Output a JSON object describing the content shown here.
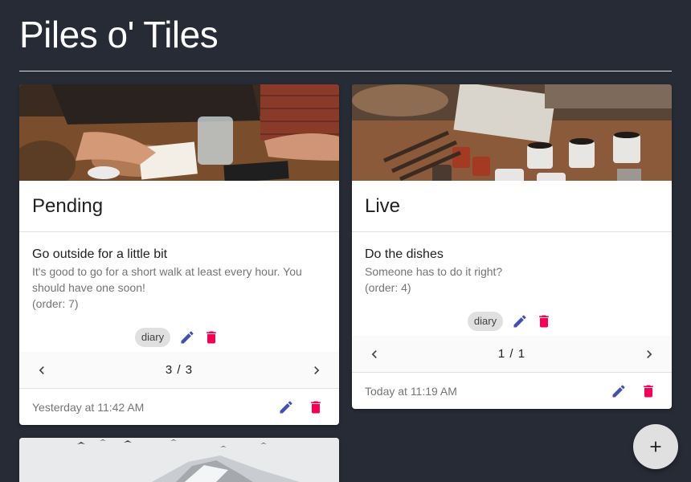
{
  "app": {
    "title": "Piles o' Tiles"
  },
  "colors": {
    "background": "#272b35",
    "edit": "#3f51b5",
    "delete": "#f50057",
    "fab": "#e0e0e0"
  },
  "cards": [
    {
      "header": "Pending",
      "image": "hands-writing-desk-photo",
      "item": {
        "title": "Go outside for a little bit",
        "description": "It's good to go for a short walk at least every hour. You should have one soon!",
        "order": "(order: 7)",
        "tag": "diary"
      },
      "pager": {
        "count": "3 / 3"
      },
      "footer": {
        "timestamp": "Yesterday at 11:42 AM"
      }
    },
    {
      "header": "Live",
      "image": "coffee-cups-table-photo",
      "item": {
        "title": "Do the dishes",
        "description": "Someone has to do it right?",
        "order": "(order: 4)",
        "tag": "diary"
      },
      "pager": {
        "count": "1 / 1"
      },
      "footer": {
        "timestamp": "Today at 11:19 AM"
      }
    },
    {
      "image": "snowy-mountain-birds-photo"
    }
  ],
  "fab": {
    "icon": "plus-icon"
  }
}
